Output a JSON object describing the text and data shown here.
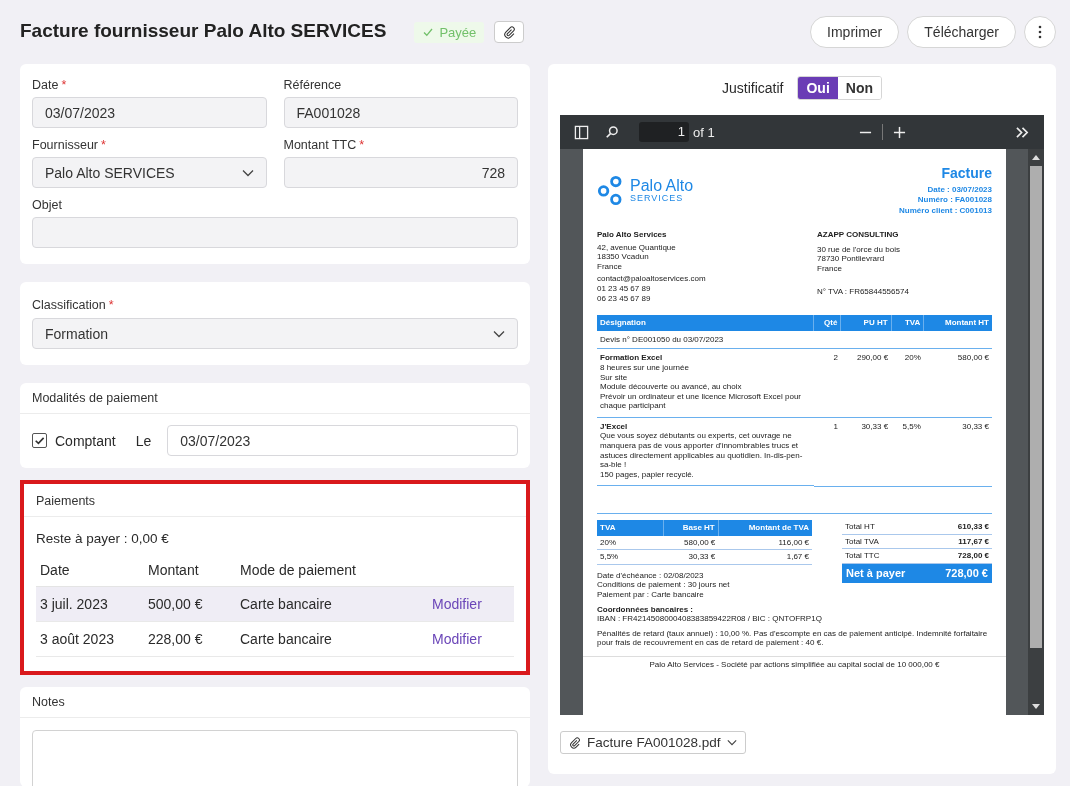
{
  "header": {
    "title": "Facture fournisseur Palo Alto SERVICES",
    "status": {
      "label": "Payée",
      "paid": true
    },
    "actions": [
      "Imprimer",
      "Télécharger"
    ]
  },
  "details": {
    "fields": [
      {
        "label": "Date",
        "marker": "*",
        "value": "03/07/2023",
        "kind": "text"
      },
      {
        "label": "Référence",
        "value": "FA001028",
        "kind": "text"
      },
      {
        "label": "Fournisseur",
        "marker": "*",
        "value": "Palo Alto SERVICES",
        "kind": "select"
      },
      {
        "label": "Montant TTC",
        "marker": "*",
        "value": "728",
        "kind": "number"
      }
    ],
    "subject": {
      "label": "Objet"
    }
  },
  "classification": {
    "label": "Classification",
    "marker": "*",
    "value": "Formation"
  },
  "payment_terms": {
    "title": "Modalités de paiement",
    "cash": {
      "label": "Comptant",
      "checked": true
    },
    "date_label": "Le",
    "date": "03/07/2023"
  },
  "payments": {
    "title": "Paiements",
    "highlighted": true,
    "remaining": "Reste à payer : 0,00 €",
    "columns": [
      "Date",
      "Montant",
      "Mode de paiement"
    ],
    "rows": [
      {
        "date": "3 juil. 2023",
        "amount": "500,00 €",
        "mode": "Carte bancaire",
        "action": "Modifier",
        "selected": true
      },
      {
        "date": "3 août 2023",
        "amount": "228,00 €",
        "mode": "Carte bancaire",
        "action": "Modifier",
        "selected": false
      }
    ]
  },
  "notes": {
    "title": "Notes"
  },
  "receipt": {
    "label": "Justificatif",
    "options": [
      {
        "label": "Oui",
        "selected": true
      },
      {
        "label": "Non",
        "selected": false
      }
    ],
    "file": "Facture FA001028.pdf"
  },
  "viewer": {
    "page": "1",
    "of": "of 1"
  },
  "invoice": {
    "logo": {
      "name": "Palo Alto",
      "sub": "SERVICES"
    },
    "title": "Facture",
    "meta": [
      "Date : 03/07/2023",
      "Numéro : FA001028",
      "Numéro client : C001013"
    ],
    "seller": {
      "name": "Palo Alto Services",
      "address": [
        "42, avenue Quantique",
        "18350 Vcadun",
        "France"
      ],
      "contacts": [
        "contact@paloaltoservices.com",
        "01 23 45 67 89",
        "06 23 45 67 89"
      ]
    },
    "buyer": {
      "name": "AZAPP CONSULTING",
      "address": [
        "30 rue de l'orce du bois",
        "78730 Pontlievrard",
        "France"
      ],
      "vat": "N° TVA : FR65844556574"
    },
    "columns": [
      "Désignation",
      "Qté",
      "PU HT",
      "TVA",
      "Montant HT"
    ],
    "quote": "Devis n° DE001050 du 03/07/2023",
    "items": [
      {
        "name": "Formation Excel",
        "lines": [
          "8 heures sur une journée",
          "Sur site",
          "Module découverte ou avancé, au choix",
          "Prévoir un ordinateur et une licence Microsoft Excel pour chaque participant"
        ],
        "qty": "2",
        "unit": "290,00 €",
        "vat": "20%",
        "total": "580,00 €"
      },
      {
        "name": "J'Excel",
        "lines": [
          "Que vous soyez débutants ou experts, cet ouvrage ne manquera pas de vous apporter d'innombrables trucs et astuces directement applicables au quotidien. In-dis-pen-sa-ble !",
          "150 pages, papier recyclé."
        ],
        "qty": "1",
        "unit": "30,33 €",
        "vat": "5,5%",
        "total": "30,33 €"
      }
    ],
    "vat_columns": [
      "TVA",
      "Base HT",
      "Montant de TVA"
    ],
    "vat_rows": [
      [
        "20%",
        "580,00 €",
        "116,00 €"
      ],
      [
        "5,5%",
        "30,33 €",
        "1,67 €"
      ]
    ],
    "totals": [
      [
        "Total HT",
        "610,33 €"
      ],
      [
        "Total TVA",
        "117,67 €"
      ],
      [
        "Total TTC",
        "728,00 €"
      ]
    ],
    "net": [
      "Net à payer",
      "728,00 €"
    ],
    "terms": [
      "Date d'échéance : 02/08/2023",
      "Conditions de paiement : 30 jours net",
      "Paiement par : Carte bancaire"
    ],
    "bank_title": "Coordonnées bancaires :",
    "bank": "IBAN : FR4214508000408383859422R08 / BIC : QNTOFRP1Q",
    "penalties": "Pénalités de retard (taux annuel) : 10,00 %. Pas d'escompte en cas de paiement anticipé. Indemnité forfaitaire pour frais de recouvrement en cas de retard de paiement : 40 €.",
    "footer": "Palo Alto Services - Société par actions simplifiée au capital social de 10 000,00 €"
  }
}
